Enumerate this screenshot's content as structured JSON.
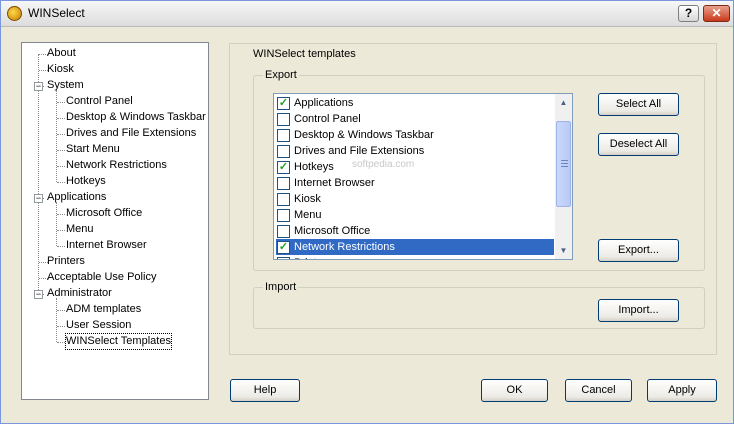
{
  "window": {
    "title": "WINSelect",
    "help_glyph": "?",
    "close_glyph": "✕"
  },
  "tree": {
    "items": [
      {
        "label": "About",
        "level": 0
      },
      {
        "label": "Kiosk",
        "level": 0
      },
      {
        "label": "System",
        "level": 0,
        "expander": "−"
      },
      {
        "label": "Control Panel",
        "level": 1
      },
      {
        "label": "Desktop & Windows Taskbar",
        "level": 1
      },
      {
        "label": "Drives and File Extensions",
        "level": 1
      },
      {
        "label": "Start Menu",
        "level": 1
      },
      {
        "label": "Network Restrictions",
        "level": 1
      },
      {
        "label": "Hotkeys",
        "level": 1
      },
      {
        "label": "Applications",
        "level": 0,
        "expander": "−"
      },
      {
        "label": "Microsoft Office",
        "level": 1
      },
      {
        "label": "Menu",
        "level": 1
      },
      {
        "label": "Internet Browser",
        "level": 1
      },
      {
        "label": "Printers",
        "level": 0
      },
      {
        "label": "Acceptable Use Policy",
        "level": 0
      },
      {
        "label": "Administrator",
        "level": 0,
        "expander": "−"
      },
      {
        "label": "ADM templates",
        "level": 1
      },
      {
        "label": "User Session",
        "level": 1
      },
      {
        "label": "WINSelect Templates",
        "level": 1,
        "selected": true
      }
    ]
  },
  "templates": {
    "title": "WINSelect templates",
    "export_label": "Export",
    "import_label": "Import",
    "list": [
      {
        "label": "Applications",
        "checked": true
      },
      {
        "label": "Control Panel",
        "checked": false
      },
      {
        "label": "Desktop & Windows Taskbar",
        "checked": false
      },
      {
        "label": "Drives and File Extensions",
        "checked": false
      },
      {
        "label": "Hotkeys",
        "checked": true
      },
      {
        "label": "Internet Browser",
        "checked": false
      },
      {
        "label": "Kiosk",
        "checked": false
      },
      {
        "label": "Menu",
        "checked": false
      },
      {
        "label": "Microsoft Office",
        "checked": false
      },
      {
        "label": "Network Restrictions",
        "checked": true,
        "selected": true
      },
      {
        "label": "Printers",
        "checked": false
      }
    ],
    "check_glyph": "✓",
    "select_all": "Select All",
    "deselect_all": "Deselect All",
    "export_button": "Export...",
    "import_button": "Import...",
    "watermark": "softpedia.com"
  },
  "footer": {
    "help": "Help",
    "ok": "OK",
    "cancel": "Cancel",
    "apply": "Apply"
  },
  "colors": {
    "selection": "#316ac5",
    "window_bg": "#ece9d8",
    "check": "#21a121"
  }
}
